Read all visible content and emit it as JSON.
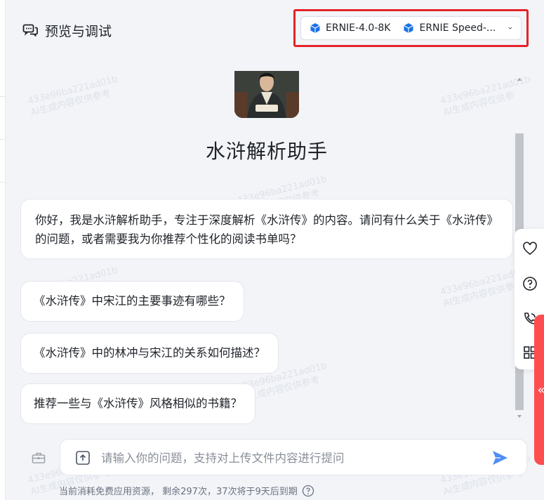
{
  "header": {
    "title": "预览与调试",
    "icon": "chat-bubble-icon"
  },
  "models": [
    {
      "name": "ERNIE-4.0-8K",
      "icon": "cube-icon",
      "color": "#1a73e8"
    },
    {
      "name": "ERNIE Speed-...",
      "icon": "cube-icon",
      "color": "#1a73e8"
    }
  ],
  "bot": {
    "name": "水浒解析助手"
  },
  "welcome_message": "你好，我是水浒解析助手，专注于深度解析《水浒传》的内容。请问有什么关于《水浒传》的问题，或者需要我为你推荐个性化的阅读书单吗？",
  "suggestions": [
    "《水浒传》中宋江的主要事迹有哪些？",
    "《水浒传》中的林冲与宋江的关系如何描述？",
    "推荐一些与《水浒传》风格相似的书籍？"
  ],
  "input": {
    "placeholder": "请输入你的问题，支持对上传文件内容进行提问"
  },
  "footer": {
    "text": "当前消耗免费应用资源， 剩余297次，37次将于9天后到期"
  },
  "watermark": {
    "line1": "433e96ba221ad01b",
    "line2": "AI生成内容仅供参考"
  },
  "side_panel": {
    "icons": [
      "heart-icon",
      "help-circle-icon",
      "phone-icon",
      "grid-icon"
    ],
    "expand_label": "«"
  },
  "colors": {
    "highlight_border": "#e5232a",
    "send": "#4f8ef7",
    "tab": "#ff4d4f"
  }
}
